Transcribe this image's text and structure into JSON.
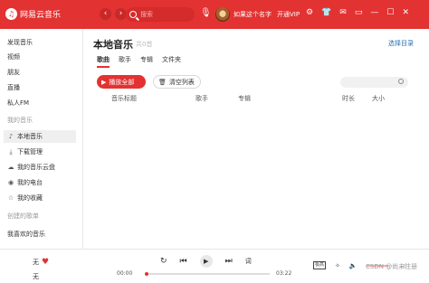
{
  "app": {
    "name": "网易云音乐",
    "search_placeholder": "搜索",
    "username": "如果这个名字",
    "vip_label": "开通VIP"
  },
  "sidebar": {
    "items": [
      "发现音乐",
      "视频",
      "朋友",
      "直播",
      "私人FM"
    ],
    "my_music_title": "我的音乐",
    "my_music": [
      {
        "icon": "music-note-icon",
        "label": "本地音乐",
        "active": true
      },
      {
        "icon": "download-icon",
        "label": "下载管理",
        "active": false
      },
      {
        "icon": "cloud-icon",
        "label": "我的音乐云盘",
        "active": false
      },
      {
        "icon": "radio-icon",
        "label": "我的电台",
        "active": false
      },
      {
        "icon": "star-icon",
        "label": "我的收藏",
        "active": false
      }
    ],
    "created_title": "创建的歌单",
    "liked_playlist": "我喜欢的音乐"
  },
  "main": {
    "title": "本地音乐",
    "count": "共0首",
    "choose_dir": "选择目录",
    "tabs": [
      "歌曲",
      "歌手",
      "专辑",
      "文件夹"
    ],
    "play_all": "播放全部",
    "clear_list": "清空列表",
    "columns": [
      "音乐标题",
      "歌手",
      "专辑",
      "时长",
      "大小"
    ]
  },
  "player": {
    "song": "无",
    "artist": "无",
    "current_time": "00:00",
    "total_time": "03:22",
    "lyric_label": "词",
    "quality_label": "极高",
    "progress": 0,
    "volume": 0.8
  },
  "watermark": "CSDN @尚未注册",
  "colors": {
    "brand": "#e33232",
    "link": "#2b6cb3"
  }
}
